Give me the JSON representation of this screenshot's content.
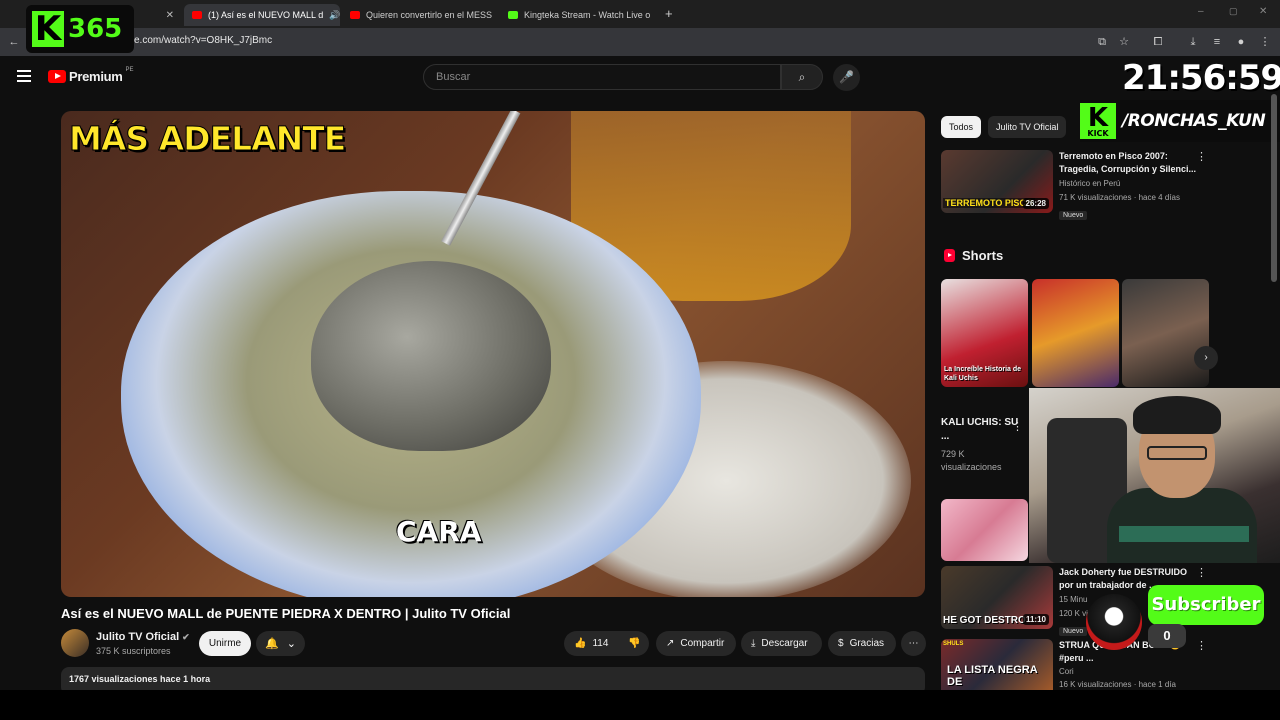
{
  "browser": {
    "tabs": [
      {
        "label": "be",
        "active": false
      },
      {
        "label": "(1) Así es el NUEVO MALL d",
        "active": true
      },
      {
        "label": "Quieren convertirlo en el MESS",
        "active": false
      },
      {
        "label": "Kingteka Stream - Watch Live o",
        "active": false
      }
    ],
    "url": "e.com/watch?v=O8HK_J7jBmc"
  },
  "overlay": {
    "logo_k": "K",
    "logo_num": "365",
    "clock": "21:56:59",
    "kick_k": "K",
    "kick_small": "KICK",
    "kick_user": "/RONCHAS_KUN",
    "subscriber_label": "Subscriber",
    "subscriber_count": "0"
  },
  "youtube": {
    "brand": "Premium",
    "region": "PE",
    "search_placeholder": "Buscar"
  },
  "video": {
    "caption_top": "MÁS ADELANTE",
    "caption_mid": "CARA",
    "title": "Así es el NUEVO MALL de PUENTE PIEDRA X DENTRO | Julito TV Oficial",
    "channel": "Julito TV Oficial",
    "subscribers": "375 K suscriptores",
    "join": "Unirme",
    "likes": "114",
    "share": "Compartir",
    "download": "Descargar",
    "thanks": "Gracias",
    "meta": "1767 visualizaciones  hace 1 hora"
  },
  "sidebar": {
    "chips": [
      "Todos",
      "Julito TV Oficial"
    ],
    "rec1": {
      "thumb_text": "TERREMOTO PISCO",
      "duration": "26:28",
      "title": "Terremoto en Pisco 2007: Tragedia, Corrupción y Silenci...",
      "channel": "Histórico en Perú",
      "meta": "71 K visualizaciones · hace 4 días",
      "badge": "Nuevo"
    },
    "shorts_heading": "Shorts",
    "short1_label": "La Increíble Historia de Kali Uchis",
    "short_title": "KALI UCHIS: SU ...",
    "short_views": "729 K visualizaciones",
    "rec2": {
      "thumb_text": "HE GOT DESTRO",
      "duration": "11:10",
      "title": "Jack Doherty fue DESTRUIDO por un trabajador de ...",
      "meta1": "15 Minu",
      "meta2": "120 K vi",
      "badge": "Nuevo"
    },
    "rec3": {
      "thumb_label": "SHULS",
      "thumb_text": "LA LISTA NEGRA DE",
      "title": "STRUA QUE USAN BOTS 😳 #peru ...",
      "channel": "Cori",
      "meta": "16 K visualizaciones · hace 1 día"
    }
  },
  "colors": {
    "kick_green": "#53fc18",
    "yt_red": "#ff0000",
    "caption_yellow": "#ffe72b"
  }
}
